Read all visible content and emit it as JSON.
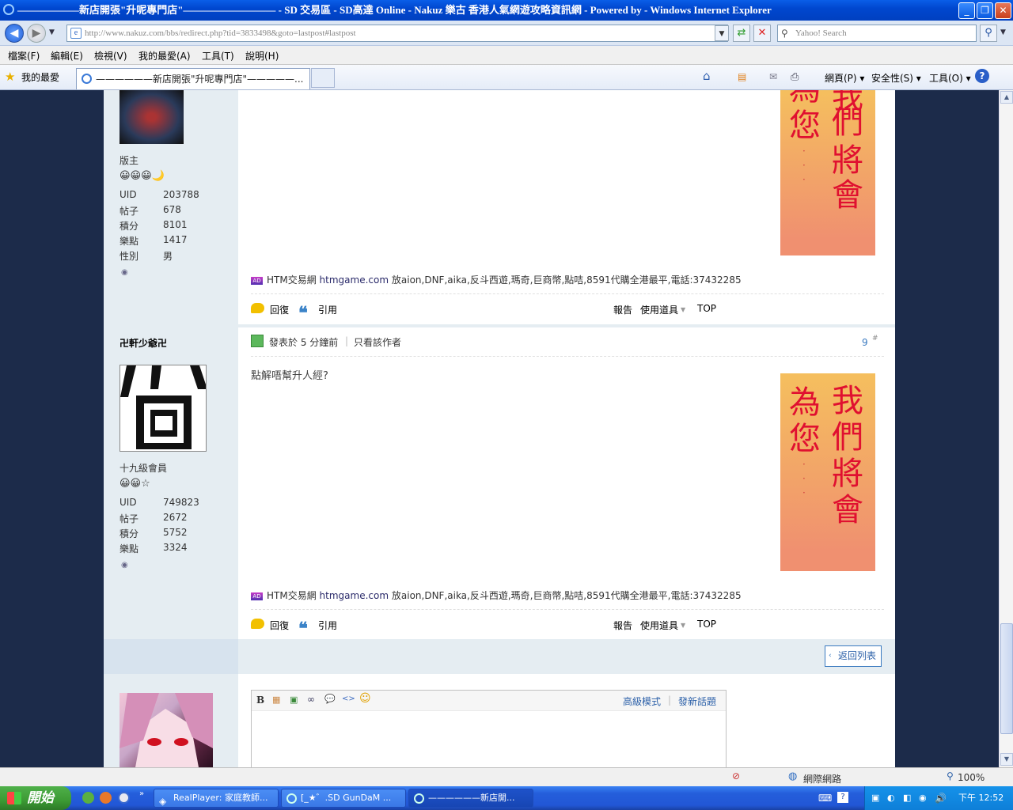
{
  "window": {
    "title": "——————新店開張\"升呢專門店\"————————— - SD 交易區 - SD高達 Online - Nakuz 樂古 香港人氣網遊攻略資訊網 - Powered by  - Windows Internet Explorer",
    "min": "_",
    "max": "❐",
    "close": "✕"
  },
  "address": {
    "url": "http://www.nakuz.com/bbs/redirect.php?tid=3833498&goto=lastpost#lastpost",
    "search_placeholder": "Yahoo! Search"
  },
  "menu": [
    "檔案(F)",
    "編輯(E)",
    "檢視(V)",
    "我的最愛(A)",
    "工具(T)",
    "說明(H)"
  ],
  "favbar": {
    "favorites": "我的最愛",
    "tab_title": "——————新店開張\"升呢專門店\"—————...",
    "tools": [
      "網頁(P) ▾",
      "安全性(S) ▾",
      "工具(O) ▾"
    ]
  },
  "posts": [
    {
      "username": "",
      "rank": "版主",
      "stars": "😀😀😀🌙",
      "stats": [
        {
          "k": "UID",
          "v": "203788"
        },
        {
          "k": "帖子",
          "v": "678"
        },
        {
          "k": "積分",
          "v": "8101"
        },
        {
          "k": "樂點",
          "v": "1417"
        },
        {
          "k": "性別",
          "v": "男"
        }
      ]
    },
    {
      "username": "卍軒少爺卍",
      "rank": "十九級會員",
      "stars": "😀😀☆",
      "posted": "發表於 5 分鐘前",
      "only_author": "只看該作者",
      "floor": "9",
      "floor_mark": "#",
      "body": "點解唔幫升人經?",
      "stats": [
        {
          "k": "UID",
          "v": "749823"
        },
        {
          "k": "帖子",
          "v": "2672"
        },
        {
          "k": "積分",
          "v": "5752"
        },
        {
          "k": "樂點",
          "v": "3324"
        }
      ]
    }
  ],
  "banner": {
    "col1": [
      "為",
      "您"
    ],
    "col2": [
      "我",
      "們",
      "將",
      "會"
    ],
    "dots": "·\n·\n·"
  },
  "ad": {
    "badge": "AD",
    "prefix": "HTM交易網",
    "link": "htmgame.com",
    "text": "放aion,DNF,aika,反斗西遊,瑪奇,巨商幣,點咭,8591代購全港最平,電話:37432285"
  },
  "actions": {
    "reply": "回復",
    "quote": "引用",
    "report": "報告",
    "use_tool": "使用道具",
    "top": "TOP"
  },
  "back_to_list": "返回列表",
  "editor": {
    "tools": [
      "B",
      "▦",
      "▣",
      "∞",
      "💬",
      "<>",
      "☺"
    ],
    "advanced": "高級模式",
    "new_topic": "發新話題"
  },
  "status": {
    "zone": "網際網路",
    "zoom": "100%"
  },
  "taskbar": {
    "start": "開始",
    "buttons": [
      "RealPlayer: 家庭教師...",
      "[_★゛.SD GunDaM ...",
      "——————新店開..."
    ],
    "clock": "下午 12:52"
  }
}
